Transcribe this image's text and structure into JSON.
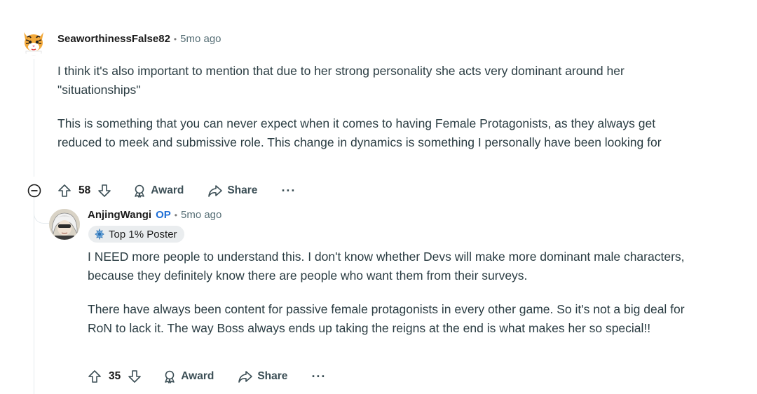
{
  "comments": [
    {
      "username": "SeaworthinessFalse82",
      "separator": "•",
      "timestamp": "5mo ago",
      "avatar_icon": "tiger-avatar-icon",
      "paragraphs": [
        "I think it's also important to mention that due to her strong personality she acts very dominant around her \"situationships\"",
        "This is something that you can never expect when it comes to having Female Protagonists, as they always get reduced to meek and submissive role. This change in dynamics is something I personally have been looking for"
      ],
      "votes": "58",
      "award_label": "Award",
      "share_label": "Share",
      "more_label": "···"
    },
    {
      "username": "AnjingWangi",
      "op_tag": "OP",
      "separator": "•",
      "timestamp": "5mo ago",
      "avatar_icon": "anime-character-avatar-icon",
      "flair": "Top 1% Poster",
      "paragraphs": [
        "I NEED more people to understand this. I don't know whether Devs will make more dominant male characters, because they definitely know there are people who want them from their surveys.",
        "There have always been content for passive female protagonists in every other game. So it's not a big deal for RoN to lack it. The way Boss always ends up taking the reigns at the end is what makes her so special!!"
      ],
      "votes": "35",
      "award_label": "Award",
      "share_label": "Share",
      "more_label": "···"
    }
  ],
  "colors": {
    "op_blue": "#1f6fd6",
    "thread_line": "#e5ebee",
    "body_text": "#2a3c42",
    "meta_text": "#576f76",
    "flair_bg": "#eaedef"
  }
}
